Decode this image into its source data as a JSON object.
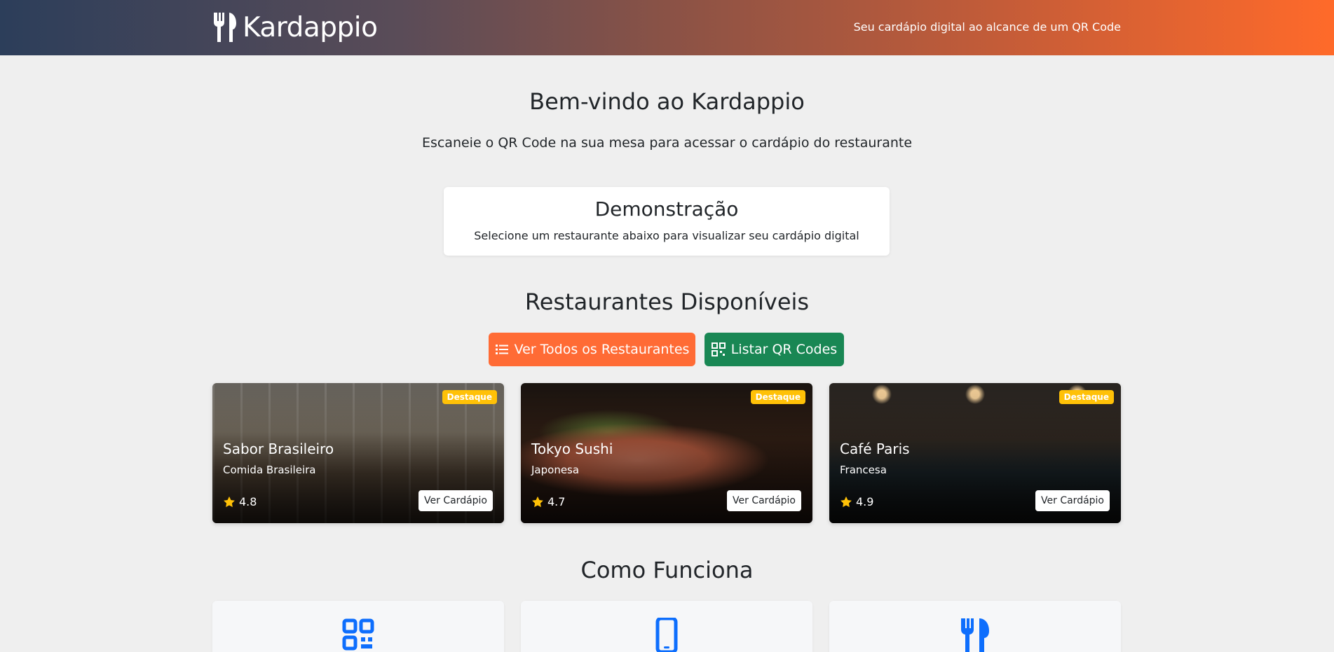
{
  "header": {
    "brand": "Kardappio",
    "tagline": "Seu cardápio digital ao alcance de um QR Code"
  },
  "hero": {
    "title": "Bem-vindo ao Kardappio",
    "subtitle": "Escaneie o QR Code na sua mesa para acessar o cardápio do restaurante"
  },
  "demo": {
    "title": "Demonstração",
    "text": "Selecione um restaurante abaixo para visualizar seu cardápio digital"
  },
  "restaurants_section": {
    "title": "Restaurantes Disponíveis",
    "view_all_label": "Ver Todos os Restaurantes",
    "list_qr_label": "Listar QR Codes"
  },
  "restaurants": [
    {
      "name": "Sabor Brasileiro",
      "cuisine": "Comida Brasileira",
      "rating": "4.8",
      "badge": "Destaque",
      "button": "Ver Cardápio"
    },
    {
      "name": "Tokyo Sushi",
      "cuisine": "Japonesa",
      "rating": "4.7",
      "badge": "Destaque",
      "button": "Ver Cardápio"
    },
    {
      "name": "Café Paris",
      "cuisine": "Francesa",
      "rating": "4.9",
      "badge": "Destaque",
      "button": "Ver Cardápio"
    }
  ],
  "how": {
    "title": "Como Funciona",
    "steps": [
      {
        "icon": "qr-code-icon"
      },
      {
        "icon": "phone-icon"
      },
      {
        "icon": "utensils-icon"
      }
    ]
  },
  "colors": {
    "accent_orange": "#ff6b35",
    "accent_green": "#198754",
    "badge_yellow": "#ffc107",
    "icon_blue": "#0d6efd"
  }
}
